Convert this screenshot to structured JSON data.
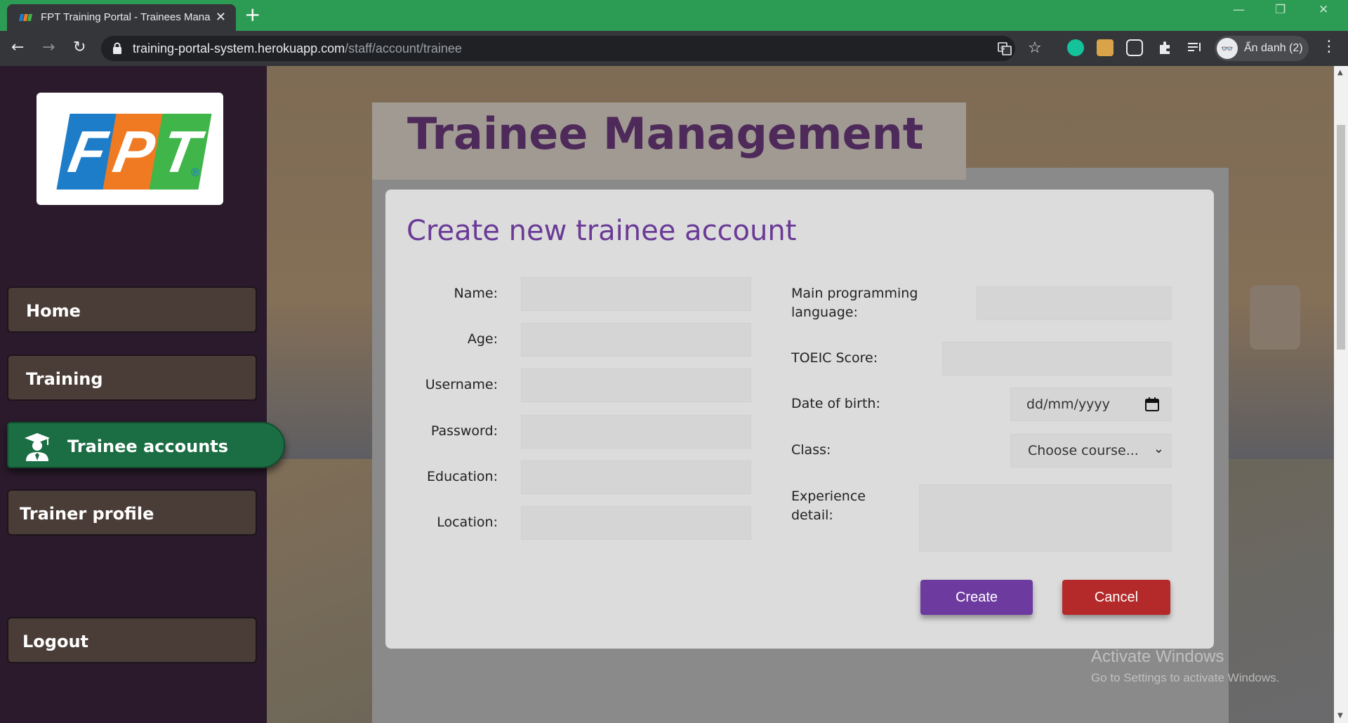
{
  "browser": {
    "tab_title": "FPT Training Portal - Trainees Manag",
    "url_host": "training-portal-system.herokuapp.com",
    "url_path": "/staff/account/trainee",
    "profile_label": "Ẩn danh (2)",
    "close_glyph": "✕",
    "new_tab_glyph": "+",
    "back_glyph": "←",
    "forward_glyph": "→",
    "reload_glyph": "↻",
    "star_glyph": "☆",
    "menu_glyph": "⋮",
    "minimize_glyph": "—",
    "restore_glyph": "❐",
    "accent": "#2c9b53"
  },
  "sidebar": {
    "logo_letters": [
      "F",
      "P",
      "T"
    ],
    "logo_colors": [
      "#1e7dc9",
      "#f07a22",
      "#3fb54a"
    ],
    "logo_reg": "®",
    "items": [
      {
        "label": "Home",
        "icon": null
      },
      {
        "label": "Training",
        "icon": null
      },
      {
        "label": "Trainee accounts",
        "icon": "graduate-icon",
        "active": true
      },
      {
        "label": "Trainer profile",
        "icon": null
      }
    ],
    "logout_label": "Logout"
  },
  "background": {
    "page_title": "Trainee Management"
  },
  "modal": {
    "title": "Create new trainee account",
    "left_fields": [
      {
        "label": "Name:",
        "value": ""
      },
      {
        "label": "Age:",
        "value": ""
      },
      {
        "label": "Username:",
        "value": ""
      },
      {
        "label": "Password:",
        "value": ""
      },
      {
        "label": "Education:",
        "value": ""
      },
      {
        "label": "Location:",
        "value": ""
      }
    ],
    "right_fields": {
      "main_language_label_1": "Main programming",
      "main_language_label_2": "language:",
      "toeic_label": "TOEIC Score:",
      "dob_label": "Date of birth:",
      "dob_placeholder": "dd/mm/yyyy",
      "class_label": "Class:",
      "class_selected": "Choose course...",
      "experience_label_1": "Experience",
      "experience_label_2": "detail:"
    },
    "create_label": "Create",
    "cancel_label": "Cancel",
    "create_color": "#6d3ba0",
    "cancel_color": "#b42a2a"
  },
  "watermark": {
    "line1": "Activate Windows",
    "line2": "Go to Settings to activate Windows."
  }
}
